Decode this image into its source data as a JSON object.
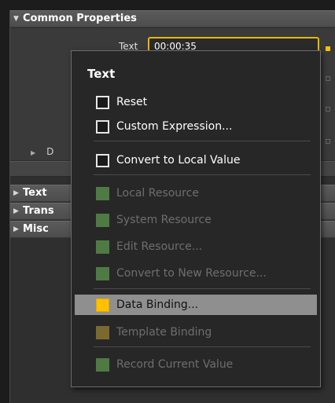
{
  "panel": {
    "sections": [
      {
        "label": "Common Properties",
        "expanded": true
      },
      {
        "label": "Text",
        "expanded": false
      },
      {
        "label": "Trans",
        "expanded": false
      },
      {
        "label": "Misc",
        "expanded": false
      }
    ],
    "text_property": {
      "label": "Text",
      "value": "00:00:35"
    },
    "collapsed_row_label": "D"
  },
  "menu": {
    "title": "Text",
    "items": [
      {
        "label": "Reset",
        "icon": "checkbox-icon",
        "enabled": true
      },
      {
        "label": "Custom Expression...",
        "icon": "checkbox-icon",
        "enabled": true
      },
      {
        "label": "Convert to Local Value",
        "icon": "checkbox-icon",
        "enabled": true
      },
      {
        "label": "Local Resource",
        "icon": "resource-icon",
        "enabled": false
      },
      {
        "label": "System Resource",
        "icon": "resource-icon",
        "enabled": false
      },
      {
        "label": "Edit Resource...",
        "icon": "resource-icon",
        "enabled": false
      },
      {
        "label": "Convert to New Resource...",
        "icon": "resource-icon",
        "enabled": false
      },
      {
        "label": "Data Binding...",
        "icon": "binding-icon",
        "enabled": true,
        "highlighted": true
      },
      {
        "label": "Template Binding",
        "icon": "binding-icon",
        "enabled": false
      },
      {
        "label": "Record Current Value",
        "icon": "resource-icon",
        "enabled": false
      }
    ]
  },
  "colors": {
    "accent": "#ffc000",
    "resource_green": "#4f7a43",
    "highlight": "#8f8f8f"
  }
}
